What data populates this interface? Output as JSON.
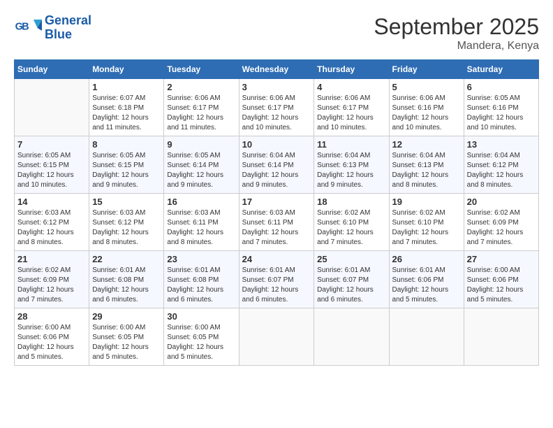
{
  "header": {
    "title": "September 2025",
    "subtitle": "Mandera, Kenya",
    "logo_line1": "General",
    "logo_line2": "Blue"
  },
  "days_of_week": [
    "Sunday",
    "Monday",
    "Tuesday",
    "Wednesday",
    "Thursday",
    "Friday",
    "Saturday"
  ],
  "weeks": [
    [
      {
        "day": "",
        "sunrise": "",
        "sunset": "",
        "daylight": ""
      },
      {
        "day": "1",
        "sunrise": "6:07 AM",
        "sunset": "6:18 PM",
        "daylight": "12 hours and 11 minutes."
      },
      {
        "day": "2",
        "sunrise": "6:06 AM",
        "sunset": "6:17 PM",
        "daylight": "12 hours and 11 minutes."
      },
      {
        "day": "3",
        "sunrise": "6:06 AM",
        "sunset": "6:17 PM",
        "daylight": "12 hours and 10 minutes."
      },
      {
        "day": "4",
        "sunrise": "6:06 AM",
        "sunset": "6:17 PM",
        "daylight": "12 hours and 10 minutes."
      },
      {
        "day": "5",
        "sunrise": "6:06 AM",
        "sunset": "6:16 PM",
        "daylight": "12 hours and 10 minutes."
      },
      {
        "day": "6",
        "sunrise": "6:05 AM",
        "sunset": "6:16 PM",
        "daylight": "12 hours and 10 minutes."
      }
    ],
    [
      {
        "day": "7",
        "sunrise": "6:05 AM",
        "sunset": "6:15 PM",
        "daylight": "12 hours and 10 minutes."
      },
      {
        "day": "8",
        "sunrise": "6:05 AM",
        "sunset": "6:15 PM",
        "daylight": "12 hours and 9 minutes."
      },
      {
        "day": "9",
        "sunrise": "6:05 AM",
        "sunset": "6:14 PM",
        "daylight": "12 hours and 9 minutes."
      },
      {
        "day": "10",
        "sunrise": "6:04 AM",
        "sunset": "6:14 PM",
        "daylight": "12 hours and 9 minutes."
      },
      {
        "day": "11",
        "sunrise": "6:04 AM",
        "sunset": "6:13 PM",
        "daylight": "12 hours and 9 minutes."
      },
      {
        "day": "12",
        "sunrise": "6:04 AM",
        "sunset": "6:13 PM",
        "daylight": "12 hours and 8 minutes."
      },
      {
        "day": "13",
        "sunrise": "6:04 AM",
        "sunset": "6:12 PM",
        "daylight": "12 hours and 8 minutes."
      }
    ],
    [
      {
        "day": "14",
        "sunrise": "6:03 AM",
        "sunset": "6:12 PM",
        "daylight": "12 hours and 8 minutes."
      },
      {
        "day": "15",
        "sunrise": "6:03 AM",
        "sunset": "6:12 PM",
        "daylight": "12 hours and 8 minutes."
      },
      {
        "day": "16",
        "sunrise": "6:03 AM",
        "sunset": "6:11 PM",
        "daylight": "12 hours and 8 minutes."
      },
      {
        "day": "17",
        "sunrise": "6:03 AM",
        "sunset": "6:11 PM",
        "daylight": "12 hours and 7 minutes."
      },
      {
        "day": "18",
        "sunrise": "6:02 AM",
        "sunset": "6:10 PM",
        "daylight": "12 hours and 7 minutes."
      },
      {
        "day": "19",
        "sunrise": "6:02 AM",
        "sunset": "6:10 PM",
        "daylight": "12 hours and 7 minutes."
      },
      {
        "day": "20",
        "sunrise": "6:02 AM",
        "sunset": "6:09 PM",
        "daylight": "12 hours and 7 minutes."
      }
    ],
    [
      {
        "day": "21",
        "sunrise": "6:02 AM",
        "sunset": "6:09 PM",
        "daylight": "12 hours and 7 minutes."
      },
      {
        "day": "22",
        "sunrise": "6:01 AM",
        "sunset": "6:08 PM",
        "daylight": "12 hours and 6 minutes."
      },
      {
        "day": "23",
        "sunrise": "6:01 AM",
        "sunset": "6:08 PM",
        "daylight": "12 hours and 6 minutes."
      },
      {
        "day": "24",
        "sunrise": "6:01 AM",
        "sunset": "6:07 PM",
        "daylight": "12 hours and 6 minutes."
      },
      {
        "day": "25",
        "sunrise": "6:01 AM",
        "sunset": "6:07 PM",
        "daylight": "12 hours and 6 minutes."
      },
      {
        "day": "26",
        "sunrise": "6:01 AM",
        "sunset": "6:06 PM",
        "daylight": "12 hours and 5 minutes."
      },
      {
        "day": "27",
        "sunrise": "6:00 AM",
        "sunset": "6:06 PM",
        "daylight": "12 hours and 5 minutes."
      }
    ],
    [
      {
        "day": "28",
        "sunrise": "6:00 AM",
        "sunset": "6:06 PM",
        "daylight": "12 hours and 5 minutes."
      },
      {
        "day": "29",
        "sunrise": "6:00 AM",
        "sunset": "6:05 PM",
        "daylight": "12 hours and 5 minutes."
      },
      {
        "day": "30",
        "sunrise": "6:00 AM",
        "sunset": "6:05 PM",
        "daylight": "12 hours and 5 minutes."
      },
      {
        "day": "",
        "sunrise": "",
        "sunset": "",
        "daylight": ""
      },
      {
        "day": "",
        "sunrise": "",
        "sunset": "",
        "daylight": ""
      },
      {
        "day": "",
        "sunrise": "",
        "sunset": "",
        "daylight": ""
      },
      {
        "day": "",
        "sunrise": "",
        "sunset": "",
        "daylight": ""
      }
    ]
  ]
}
